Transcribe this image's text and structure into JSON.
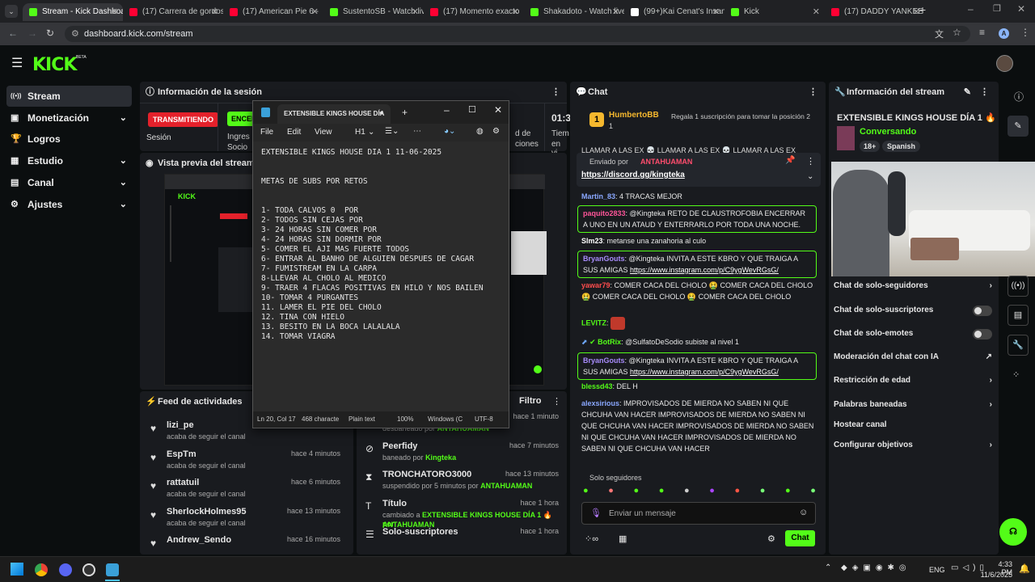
{
  "browser": {
    "tabs": [
      {
        "label": "Stream - Kick Dashboard",
        "color": "#53fc18"
      },
      {
        "label": "(17) Carrera de gordos",
        "color": "#ff0033"
      },
      {
        "label": "(17) American Pie 6 -",
        "color": "#ff0033"
      },
      {
        "label": "SustentoSB - Watch live",
        "color": "#53fc18"
      },
      {
        "label": "(17) Momento exacto",
        "color": "#ff0033"
      },
      {
        "label": "Shakadoto - Watch live",
        "color": "#53fc18"
      },
      {
        "label": "(99+)Kai Cenat's Insane",
        "color": "#ffffff"
      },
      {
        "label": "Kick",
        "color": "#53fc18"
      },
      {
        "label": "(17) DADDY YANKEE",
        "color": "#ff0033"
      }
    ],
    "url": "dashboard.kick.com/stream",
    "profile_initial": "A"
  },
  "app": {
    "logo": "KICK",
    "logo_sup": "BETA"
  },
  "sidebar": {
    "items": [
      {
        "label": "Stream",
        "icon": "broadcast-icon"
      },
      {
        "label": "Monetización",
        "icon": "wallet-icon"
      },
      {
        "label": "Logros",
        "icon": "trophy-icon"
      },
      {
        "label": "Estudio",
        "icon": "studio-icon"
      },
      {
        "label": "Canal",
        "icon": "channel-icon"
      },
      {
        "label": "Ajustes",
        "icon": "gear-icon"
      }
    ]
  },
  "session": {
    "title": "Información de la sesión",
    "status": "TRANSMITIENDO",
    "status_label": "Sesión",
    "green_badge": "ENCEN",
    "col2_label": "Ingres",
    "col2_label2": "Socio",
    "col3_label": "d de",
    "col3_label2": "ciones",
    "time": "01:3",
    "time_label": "Tiem",
    "time_label2": "en vi"
  },
  "preview": {
    "title": "Vista previa del stream"
  },
  "feed": {
    "title": "Feed de actividades",
    "items": [
      {
        "name": "lizi_pe",
        "desc": "acaba de seguir el canal",
        "time": ""
      },
      {
        "name": "EspTm",
        "desc": "acaba de seguir el canal",
        "time": "hace 4 minutos"
      },
      {
        "name": "rattatuil",
        "desc": "acaba de seguir el canal",
        "time": "hace 6 minutos"
      },
      {
        "name": "SherlockHolmes95",
        "desc": "acaba de seguir el canal",
        "time": "hace 13 minutos"
      },
      {
        "name": "Andrew_Sendo",
        "desc": "",
        "time": "hace 16 minutos"
      }
    ]
  },
  "modlog": {
    "filter": "Filtro",
    "items": [
      {
        "name": "",
        "desc": "desbaneado por",
        "by": "ANTAHUAMAN",
        "time": "hace 1 minuto"
      },
      {
        "name": "Peerfidy",
        "desc": "baneado por",
        "by": "Kingteka",
        "time": "hace 7 minutos"
      },
      {
        "name": "TRONCHATORO3000",
        "desc": "suspendido por 5 minutos por",
        "by": "ANTAHUAMAN",
        "time": "hace 13 minutos"
      },
      {
        "name": "Título",
        "desc": "cambiado a",
        "by": "EXTENSIBLE KINGS HOUSE DÍA 1 🔥 por",
        "by2": "ANTAHUAMAN",
        "time": "hace 1 hora"
      },
      {
        "name": "Solo-suscriptores",
        "desc": "",
        "by": "",
        "time": "hace 1 hora"
      }
    ]
  },
  "chat": {
    "title": "Chat",
    "gift_user": "HumbertoBB",
    "gift_count": "1",
    "gift_text": "Regala 1 suscripción para tomar la posición 2",
    "gift_rank": "1",
    "scroll_text": "LLAMAR A LAS EX 💀 LLAMAR A LAS EX 💀 LLAMAR A LAS EX",
    "pinned_by_label": "Enviado por",
    "pinned_by": "ANTAHUAMAN",
    "pinned_link": "https://discord.gg/kingteka",
    "messages": [
      {
        "user": "Martin_83",
        "color": "#8aa8ff",
        "text": "4 TRACAS MEJOR"
      },
      {
        "user": "paquito2833",
        "color": "#ff5599",
        "text": "@Kingteka RETO DE CLAUSTROFOBIA ENCERRAR A UNO EN UN ATAUD Y ENTERRARLO POR TODA UNA NOCHE."
      },
      {
        "user": "Slm23",
        "color": "#ffffff",
        "text": "metanse una zanahoria al culo"
      },
      {
        "user": "BryanGouts",
        "color": "#a78bfa",
        "text": "@Kingteka INVITA A ESTE KBRO Y QUE TRAIGA A SUS AMIGAS",
        "link": "https://www.instagram.com/p/C9ygWevRGsG/"
      },
      {
        "user": "yawar79",
        "color": "#ff4d4d",
        "text": "COMER CACA DEL CHOLO 🤮 COMER CACA DEL CHOLO 🤮 COMER CACA DEL CHOLO 🤮 COMER CACA DEL CHOLO"
      },
      {
        "user": "LEVITZ",
        "color": "#53fc18",
        "text": ""
      },
      {
        "user": "BotRix",
        "color": "#53fc18",
        "text": "@SulfatoDeSodio subiste al nivel 1"
      },
      {
        "user": "BryanGouts",
        "color": "#a78bfa",
        "text": "@Kingteka INVITA A ESTE KBRO Y QUE TRAIGA A SUS AMIGAS",
        "link": "https://www.instagram.com/p/C9ygWevRGsG/"
      },
      {
        "user": "blessd43",
        "color": "#53fc18",
        "text": "DEL H"
      },
      {
        "user": "alexsirious",
        "color": "#8aa8ff",
        "text": "IMPROVISADOS DE MIERDA NO SABEN NI QUE CHCUHA VAN HACER IMPROVISADOS DE MIERDA NO SABEN NI QUE CHCUHA VAN HACER IMPROVISADOS DE MIERDA NO SABEN NI QUE CHCUHA VAN HACER IMPROVISADOS DE MIERDA NO SABEN NI QUE CHCUHA VAN HACER"
      }
    ],
    "followers_only": "Solo seguidores",
    "input_placeholder": "Enviar un mensaje",
    "send_label": "Chat"
  },
  "streaminfo": {
    "title": "Información del stream",
    "stream_title": "EXTENSIBLE KINGS HOUSE DÍA 1 🔥",
    "category": "Conversando",
    "tags": [
      "18+",
      "Spanish"
    ],
    "settings": [
      {
        "label": "Chat de solo-seguidores",
        "type": "chevron"
      },
      {
        "label": "Chat de solo-suscriptores",
        "type": "toggle"
      },
      {
        "label": "Chat de solo-emotes",
        "type": "toggle"
      },
      {
        "label": "Moderación del chat con IA",
        "type": "external"
      },
      {
        "label": "Restricción de edad",
        "type": "chevron"
      },
      {
        "label": "Palabras baneadas",
        "type": "chevron"
      },
      {
        "label": "Hostear canal",
        "type": "none"
      },
      {
        "label": "Configurar objetivos",
        "type": "chevron"
      }
    ]
  },
  "notepad": {
    "tab_title": "EXTENSIBLE KINGS HOUSE DÍA",
    "menu": [
      "File",
      "Edit",
      "View"
    ],
    "heading": "H1",
    "lines": [
      "EXTENSIBLE KINGS HOUSE DIA 1 11-06-2025",
      "",
      "",
      "METAS DE SUBS POR RETOS",
      "",
      "",
      "1- TODA CALVOS 0  POR",
      "2- TODOS SIN CEJAS POR",
      "3- 24 HORAS SIN COMER POR",
      "4- 24 HORAS SIN DORMIR POR",
      "5- COMER EL AJI MAS FUERTE TODOS",
      "6- ENTRAR AL BANHO DE ALGUIEN DESPUES DE CAGAR",
      "7- FUMISTREAM EN LA CARPA",
      "8-LLEVAR AL CHOLO AL MEDICO",
      "9- TRAER 4 FLACAS POSITIVAS EN HILO Y NOS BAILEN",
      "10- TOMAR 4 PURGANTES",
      "11. LAMER EL PIE DEL CHOLO",
      "12. TINA CON HIELO",
      "13. BESITO EN LA BOCA LALALALA",
      "14. TOMAR VIAGRA"
    ],
    "status": {
      "pos": "Ln 20, Col 17",
      "chars": "468 characte",
      "format": "Plain text",
      "zoom": "100%",
      "eol": "Windows (C",
      "enc": "UTF-8"
    }
  },
  "taskbar": {
    "lang": "ENG",
    "time": "4:33 PM",
    "date": "11/6/2025"
  }
}
